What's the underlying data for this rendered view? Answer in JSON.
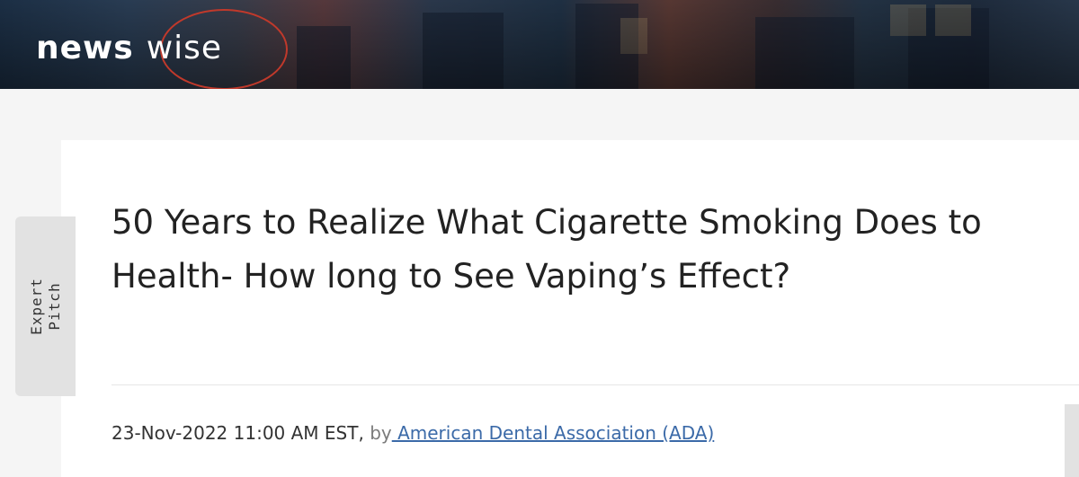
{
  "header": {
    "logo_news": "news",
    "logo_wise": "wise"
  },
  "tab": {
    "label_line1": "Expert",
    "label_line2": "Pitch"
  },
  "article": {
    "title": "50 Years to Realize What Cigarette Smoking Does to Health- How long to See Vaping’s Effect?",
    "date": "23-Nov-2022 11:00 AM EST,",
    "by_label": "by",
    "author": " American Dental Association (ADA)"
  },
  "colors": {
    "link": "#3b6aa8",
    "logo_ring": "#c0392b"
  }
}
